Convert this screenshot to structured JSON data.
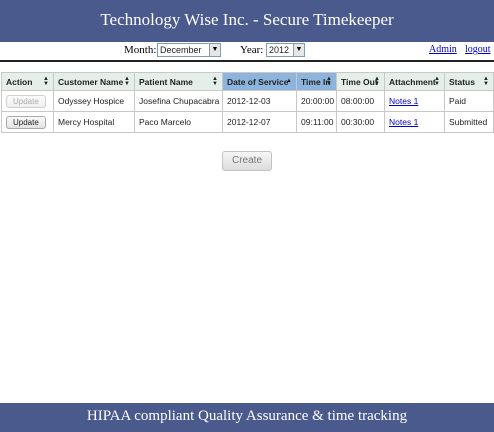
{
  "header": {
    "title": "Technology Wise Inc. - Secure Timekeeper"
  },
  "controls": {
    "month_label": "Month:",
    "month_value": "December",
    "year_label": "Year:",
    "year_value": "2012",
    "admin_link": "Admin",
    "logout_link": "logout"
  },
  "table": {
    "columns": [
      {
        "label": "Action"
      },
      {
        "label": "Customer Name"
      },
      {
        "label": "Patient Name"
      },
      {
        "label": "Date of Service",
        "sorted": "asc"
      },
      {
        "label": "Time In"
      },
      {
        "label": "Time Out"
      },
      {
        "label": "Attachment"
      },
      {
        "label": "Status"
      }
    ],
    "rows": [
      {
        "action": "Update",
        "action_enabled": false,
        "customer": "Odyssey Hospice",
        "patient": "Josefina Chupacabra",
        "date": "2012-12-03",
        "time_in": "20:00:00",
        "time_out": "08:00:00",
        "attachment": "Notes 1",
        "status": "Paid"
      },
      {
        "action": "Update",
        "action_enabled": true,
        "customer": "Mercy Hospital",
        "patient": "Paco Marcelo",
        "date": "2012-12-07",
        "time_in": "09:11:00",
        "time_out": "00:30:00",
        "attachment": "Notes 1",
        "status": "Submitted"
      }
    ]
  },
  "create_label": "Create",
  "footer": {
    "text": "HIPAA compliant Quality Assurance & time tracking"
  },
  "colors": {
    "banner": "#4a5a8c",
    "header_cell": "#e3efe8",
    "sorted_header": "#8cb4dc",
    "link": "#0000cc"
  }
}
